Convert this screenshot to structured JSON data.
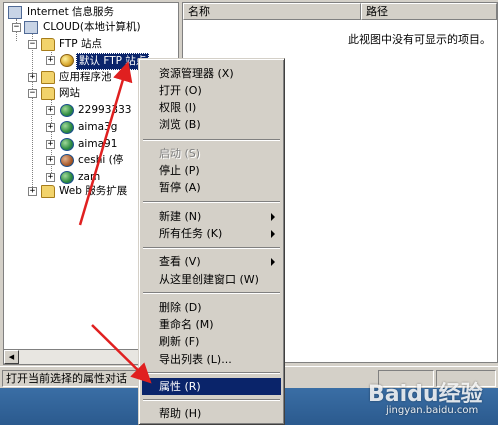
{
  "tree": {
    "items": [
      {
        "label": "Internet 信息服务"
      },
      {
        "label": "CLOUD(本地计算机)"
      },
      {
        "label": "FTP 站点"
      },
      {
        "label": "默认 FTP 站点"
      },
      {
        "label": "应用程序池"
      },
      {
        "label": "网站"
      },
      {
        "label": "22993333"
      },
      {
        "label": "aima3g"
      },
      {
        "label": "aima91"
      },
      {
        "label": "ceshi (停"
      },
      {
        "label": "zam"
      },
      {
        "label": "Web 服务扩展"
      }
    ]
  },
  "list": {
    "columns": [
      "名称",
      "路径"
    ],
    "empty_message": "此视图中没有可显示的项目。"
  },
  "status_bar": {
    "text": "打开当前选择的属性对话"
  },
  "context_menu": {
    "items": [
      {
        "label": "资源管理器 (X)"
      },
      {
        "label": "打开 (O)"
      },
      {
        "label": "权限 (I)"
      },
      {
        "label": "浏览 (B)"
      },
      {
        "label": "启动 (S)"
      },
      {
        "label": "停止 (P)"
      },
      {
        "label": "暂停 (A)"
      },
      {
        "label": "新建 (N)"
      },
      {
        "label": "所有任务 (K)"
      },
      {
        "label": "查看 (V)"
      },
      {
        "label": "从这里创建窗口 (W)"
      },
      {
        "label": "删除 (D)"
      },
      {
        "label": "重命名 (M)"
      },
      {
        "label": "刷新 (F)"
      },
      {
        "label": "导出列表 (L)..."
      },
      {
        "label": "属性 (R)"
      },
      {
        "label": "帮助 (H)"
      }
    ]
  },
  "watermark": {
    "brand": "Baidu经验",
    "url": "jingyan.baidu.com"
  },
  "colors": {
    "selection": "#0a246a",
    "annotation_arrow": "#e02020",
    "taskbar": "#3a6ea5"
  }
}
